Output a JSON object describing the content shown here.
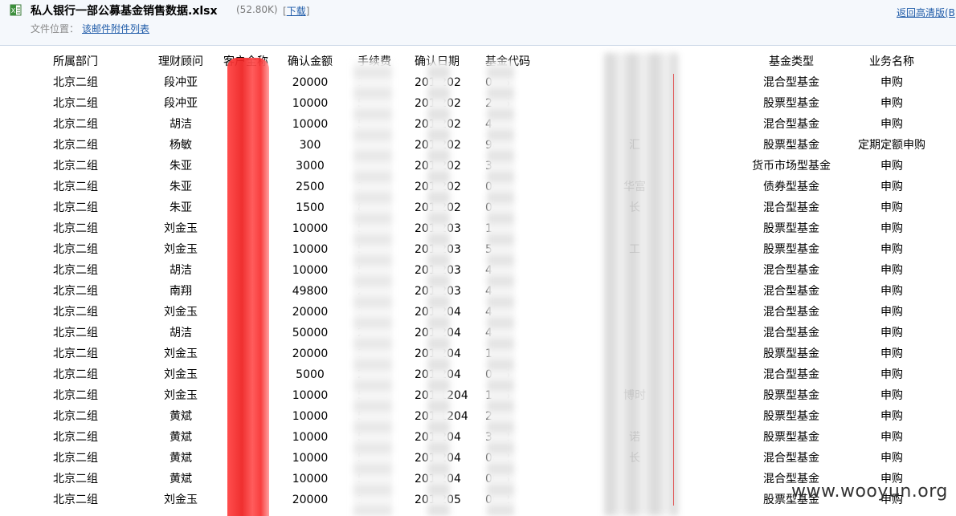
{
  "header": {
    "file_title": "私人银行一部公募基金销售数据.xlsx",
    "file_size": "(52.80K)",
    "download_label": "下载",
    "location_label": "文件位置：",
    "location_link": "该邮件附件列表",
    "hd_link": "返回高清版(B"
  },
  "table": {
    "headers": [
      "所属部门",
      "理财顾问",
      "客户全称",
      "确认金额",
      "手续费",
      "确认日期",
      "基金代码",
      "",
      "基金类型",
      "业务名称"
    ],
    "rows": [
      {
        "dept": "北京二组",
        "adv": "段冲亚",
        "amt": "20000",
        "fee": "1  28",
        "date": "201 202",
        "code": "0  45",
        "name": "",
        "type": "混合型基金",
        "biz": "申购"
      },
      {
        "dept": "北京二组",
        "adv": "段冲亚",
        "amt": "10000",
        "fee": "5",
        "date": "201 202",
        "code": "2  15",
        "name": "",
        "type": "股票型基金",
        "biz": "申购"
      },
      {
        "dept": "北京二组",
        "adv": "胡洁",
        "amt": "10000",
        "fee": "5",
        "date": "201 202",
        "code": "  45",
        "name": "",
        "type": "混合型基金",
        "biz": "申购"
      },
      {
        "dept": "北京二组",
        "adv": "杨敏",
        "amt": "300",
        "fee": "",
        "date": "201 202",
        "code": "  98",
        "name": "汇",
        "type": "股票型基金",
        "biz": "定期定额申购"
      },
      {
        "dept": "北京二组",
        "adv": "朱亚",
        "amt": "3000",
        "fee": "",
        "date": "201 202",
        "code": "  31",
        "name": "",
        "type": "货币市场型基金",
        "biz": "申购"
      },
      {
        "dept": "北京二组",
        "adv": "朱亚",
        "amt": "2500",
        "fee": "1",
        "date": "201 202",
        "code": "  04",
        "name": "华富",
        "type": "债券型基金",
        "biz": "申购"
      },
      {
        "dept": "北京二组",
        "adv": "朱亚",
        "amt": "1500",
        "fee": "8",
        "date": "201 202",
        "code": "  02",
        "name": "长",
        "type": "混合型基金",
        "biz": "申购"
      },
      {
        "dept": "北京二组",
        "adv": "刘金玉",
        "amt": "10000",
        "fee": "5",
        "date": "201 203",
        "code": "  15",
        "name": "",
        "type": "股票型基金",
        "biz": "申购"
      },
      {
        "dept": "北京二组",
        "adv": "刘金玉",
        "amt": "10000",
        "fee": "5",
        "date": "201 203",
        "code": "  51",
        "name": "工",
        "type": "股票型基金",
        "biz": "申购"
      },
      {
        "dept": "北京二组",
        "adv": "胡洁",
        "amt": "10000",
        "fee": "5",
        "date": "201 203",
        "code": "  45",
        "name": "",
        "type": "混合型基金",
        "biz": "申购"
      },
      {
        "dept": "北京二组",
        "adv": "南翔",
        "amt": "49800",
        "fee": "29",
        "date": "201 203",
        "code": "  45",
        "name": "",
        "type": "混合型基金",
        "biz": "申购"
      },
      {
        "dept": "北京二组",
        "adv": "刘金玉",
        "amt": "20000",
        "fee": "1",
        "date": "201 204",
        "code": "  45",
        "name": "",
        "type": "混合型基金",
        "biz": "申购"
      },
      {
        "dept": "北京二组",
        "adv": "胡洁",
        "amt": "50000",
        "fee": "29",
        "date": "201 204",
        "code": "  45",
        "name": "",
        "type": "混合型基金",
        "biz": "申购"
      },
      {
        "dept": "北京二组",
        "adv": "刘金玉",
        "amt": "20000",
        "fee": "119",
        "date": "201 204",
        "code": "  15",
        "name": "",
        "type": "股票型基金",
        "biz": "申购"
      },
      {
        "dept": "北京二组",
        "adv": "刘金玉",
        "amt": "5000",
        "fee": "2",
        "date": "201 204",
        "code": "0  45",
        "name": "",
        "type": "混合型基金",
        "biz": "申购"
      },
      {
        "dept": "北京二组",
        "adv": "刘金玉",
        "amt": "10000",
        "fee": "5",
        "date": "201 1204",
        "code": "1  05",
        "name": "博时",
        "type": "股票型基金",
        "biz": "申购"
      },
      {
        "dept": "北京二组",
        "adv": "黄斌",
        "amt": "10000",
        "fee": "5",
        "date": "201 1204",
        "code": "2  5",
        "name": "",
        "type": "股票型基金",
        "biz": "申购"
      },
      {
        "dept": "北京二组",
        "adv": "黄斌",
        "amt": "10000",
        "fee": "5",
        "date": "201 204",
        "code": "32  2",
        "name": "诺",
        "type": "股票型基金",
        "biz": "申购"
      },
      {
        "dept": "北京二组",
        "adv": "黄斌",
        "amt": "10000",
        "fee": "5",
        "date": "201 204",
        "code": "08  2",
        "name": "长",
        "type": "混合型基金",
        "biz": "申购"
      },
      {
        "dept": "北京二组",
        "adv": "黄斌",
        "amt": "10000",
        "fee": "5",
        "date": "201 204",
        "code": "00  5",
        "name": "",
        "type": "混合型基金",
        "biz": "申购"
      },
      {
        "dept": "北京二组",
        "adv": "刘金玉",
        "amt": "20000",
        "fee": "1",
        "date": "201 205",
        "code": "00  2",
        "name": "",
        "type": "股票型基金",
        "biz": "申购"
      }
    ]
  },
  "watermark": "www.wooyun.org",
  "colors": {
    "link": "#1f5ba8",
    "redaction": "#ee2020",
    "header_bg": "#f5f8fc"
  }
}
